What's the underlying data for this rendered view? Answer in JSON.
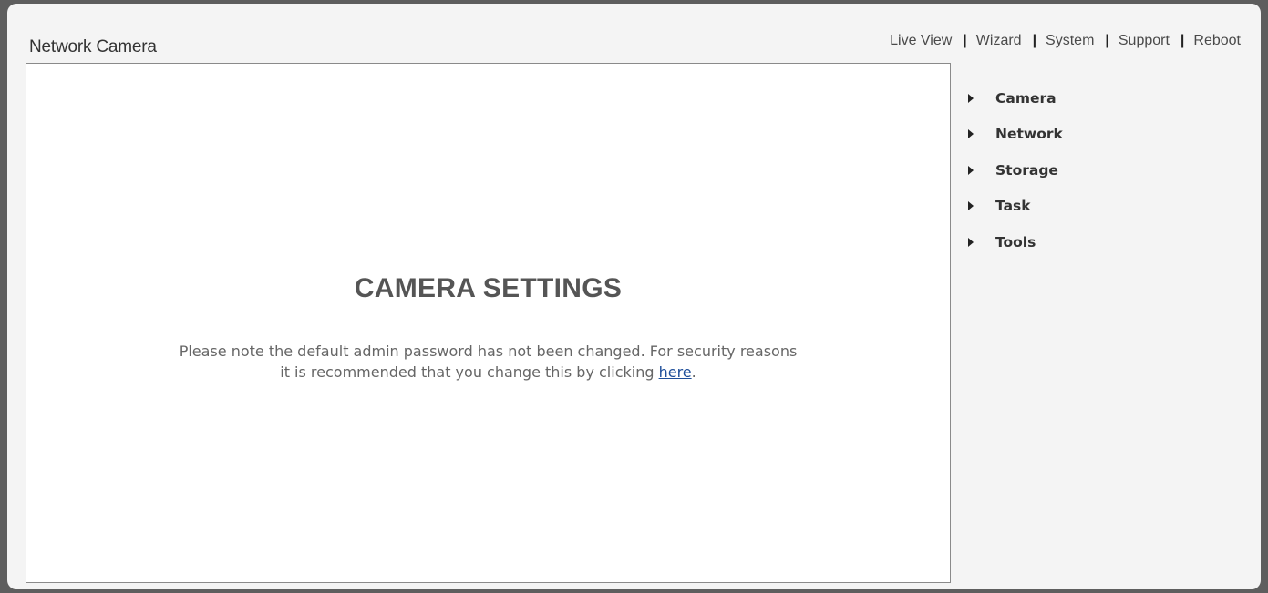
{
  "header": {
    "title": "Network Camera"
  },
  "top_nav": {
    "items": [
      {
        "label": "Live View"
      },
      {
        "label": "Wizard"
      },
      {
        "label": "System"
      },
      {
        "label": "Support"
      },
      {
        "label": "Reboot"
      }
    ],
    "separator": "|"
  },
  "content": {
    "title": "CAMERA SETTINGS",
    "note_line1": "Please note the default admin password has not been changed. For security reasons",
    "note_line2_prefix": "it is recommended that you change this by clicking ",
    "note_link": "here",
    "note_suffix": "."
  },
  "side_menu": {
    "items": [
      {
        "label": "Camera"
      },
      {
        "label": "Network"
      },
      {
        "label": "Storage"
      },
      {
        "label": "Task"
      },
      {
        "label": "Tools"
      }
    ]
  },
  "colors": {
    "frame_background": "#f4f4f4",
    "outer_background": "#5e5e5e",
    "link_color": "#1f4f9a",
    "title_color": "#555555"
  },
  "icons": {
    "menu_arrow": "triangle-right-icon"
  }
}
